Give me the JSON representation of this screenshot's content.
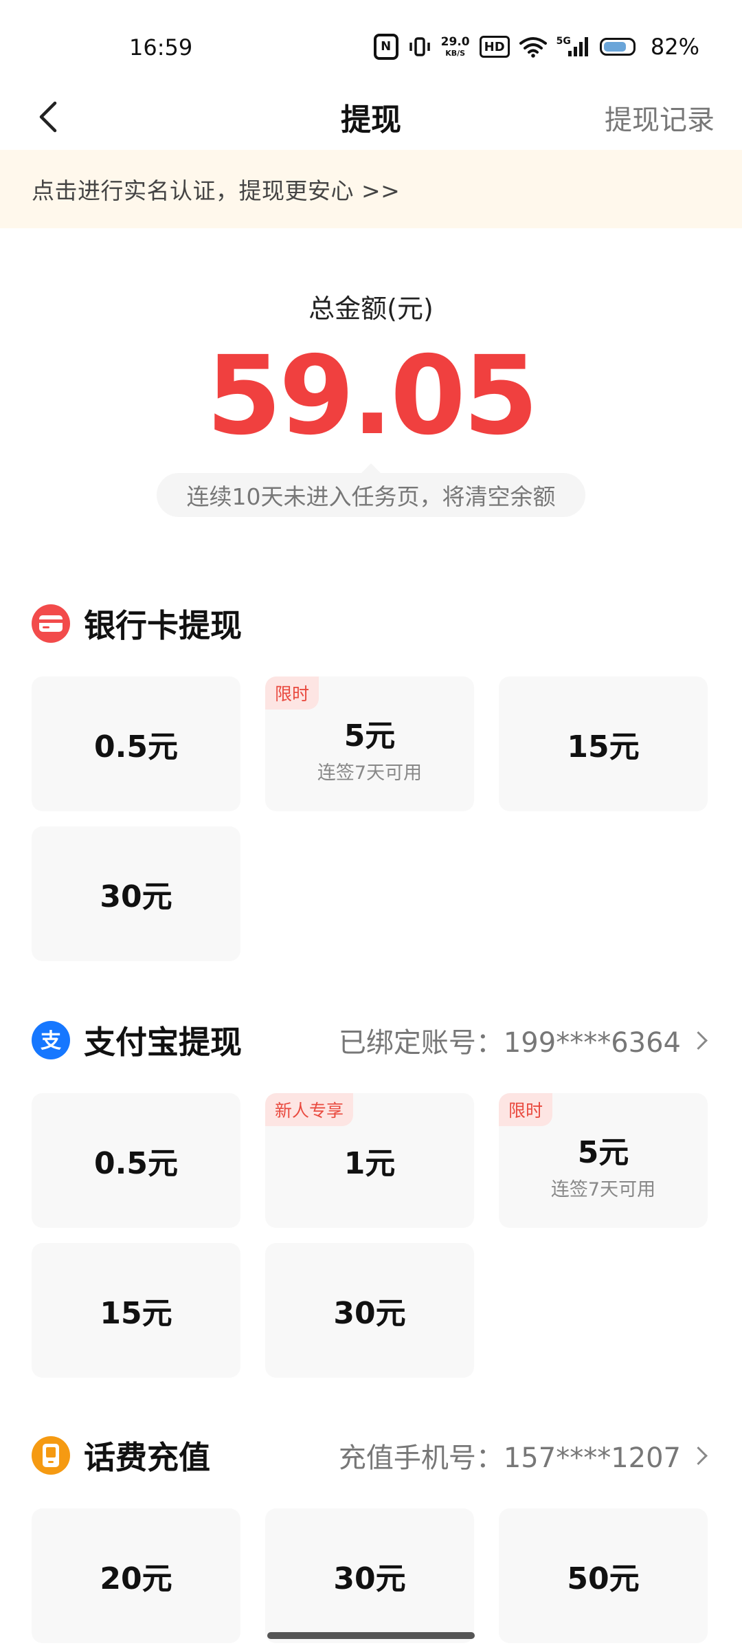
{
  "status_bar": {
    "time": "16:59",
    "nfc": "N",
    "speed_value": "29.0",
    "speed_unit": "KB/S",
    "hd": "HD",
    "network": "5G",
    "battery_text": "82%",
    "battery_level": 0.82
  },
  "header": {
    "title": "提现",
    "records_label": "提现记录"
  },
  "notice": {
    "text": "点击进行实名认证，提现更安心 >>"
  },
  "balance": {
    "label": "总金额(元)",
    "amount": "59.05",
    "tip": "连续10天未进入任务页，将清空余额"
  },
  "bank": {
    "title": "银行卡提现",
    "icon": "bank-card-icon",
    "accent": "#f24b4b",
    "options": [
      {
        "amount": "0.5元",
        "sub": "",
        "badge": ""
      },
      {
        "amount": "5元",
        "sub": "连签7天可用",
        "badge": "限时"
      },
      {
        "amount": "15元",
        "sub": "",
        "badge": ""
      },
      {
        "amount": "30元",
        "sub": "",
        "badge": ""
      }
    ]
  },
  "alipay": {
    "title": "支付宝提现",
    "icon": "alipay-icon",
    "accent": "#1677ff",
    "account_text": "已绑定账号：199****6364",
    "options": [
      {
        "amount": "0.5元",
        "sub": "",
        "badge": ""
      },
      {
        "amount": "1元",
        "sub": "",
        "badge": "新人专享"
      },
      {
        "amount": "5元",
        "sub": "连签7天可用",
        "badge": "限时"
      },
      {
        "amount": "15元",
        "sub": "",
        "badge": ""
      },
      {
        "amount": "30元",
        "sub": "",
        "badge": ""
      }
    ]
  },
  "phone": {
    "title": "话费充值",
    "icon": "phone-icon",
    "accent": "#f59a12",
    "phone_text": "充值手机号：157****1207",
    "options": [
      {
        "amount": "20元",
        "sub": "",
        "badge": ""
      },
      {
        "amount": "30元",
        "sub": "",
        "badge": ""
      },
      {
        "amount": "50元",
        "sub": "",
        "badge": ""
      }
    ]
  }
}
